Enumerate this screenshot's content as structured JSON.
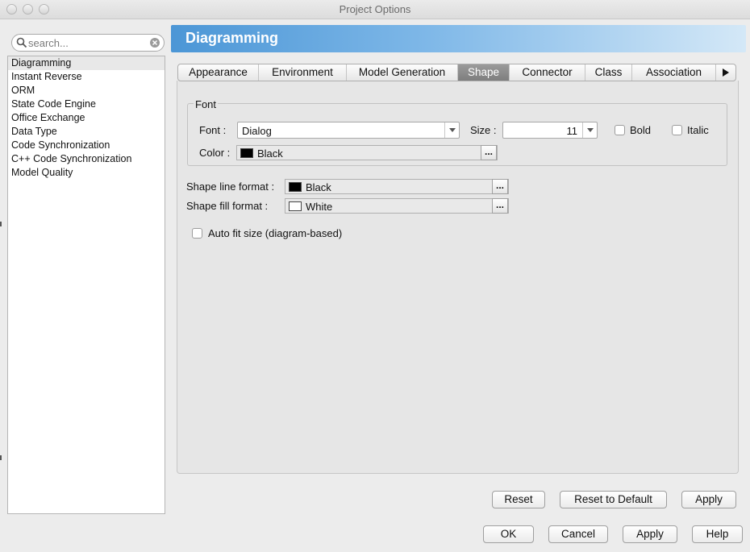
{
  "window": {
    "title": "Project Options"
  },
  "search": {
    "placeholder": "search..."
  },
  "sidebar": {
    "items": [
      {
        "label": "Diagramming",
        "selected": true
      },
      {
        "label": "Instant Reverse"
      },
      {
        "label": "ORM"
      },
      {
        "label": "State Code Engine"
      },
      {
        "label": "Office Exchange"
      },
      {
        "label": "Data Type"
      },
      {
        "label": "Code Synchronization"
      },
      {
        "label": "C++ Code Synchronization"
      },
      {
        "label": "Model Quality"
      }
    ]
  },
  "header": {
    "title": "Diagramming"
  },
  "tabs": [
    {
      "label": "Appearance"
    },
    {
      "label": "Environment"
    },
    {
      "label": "Model Generation"
    },
    {
      "label": "Shape",
      "selected": true
    },
    {
      "label": "Connector"
    },
    {
      "label": "Class"
    },
    {
      "label": "Association"
    }
  ],
  "font_group": {
    "title": "Font",
    "font_label": "Font :",
    "font_value": "Dialog",
    "size_label": "Size :",
    "size_value": "11",
    "bold_label": "Bold",
    "bold_checked": false,
    "italic_label": "Italic",
    "italic_checked": false,
    "color_label": "Color :",
    "color_name": "Black",
    "color_hex": "#000000"
  },
  "shape_line": {
    "label": "Shape line format :",
    "color_name": "Black",
    "color_hex": "#000000"
  },
  "shape_fill": {
    "label": "Shape fill format :",
    "color_name": "White",
    "color_hex": "#ffffff"
  },
  "auto_fit": {
    "label": "Auto fit size (diagram-based)",
    "checked": false
  },
  "ellipsis_label": "...",
  "panel_buttons": {
    "reset": "Reset",
    "reset_default": "Reset to Default",
    "apply": "Apply"
  },
  "dialog_buttons": {
    "ok": "OK",
    "cancel": "Cancel",
    "apply": "Apply",
    "help": "Help"
  },
  "colors": {
    "header_gradient_start": "#4b96d6",
    "header_gradient_end": "#d4e8f7",
    "selected_tab": "#8a8a8a"
  }
}
